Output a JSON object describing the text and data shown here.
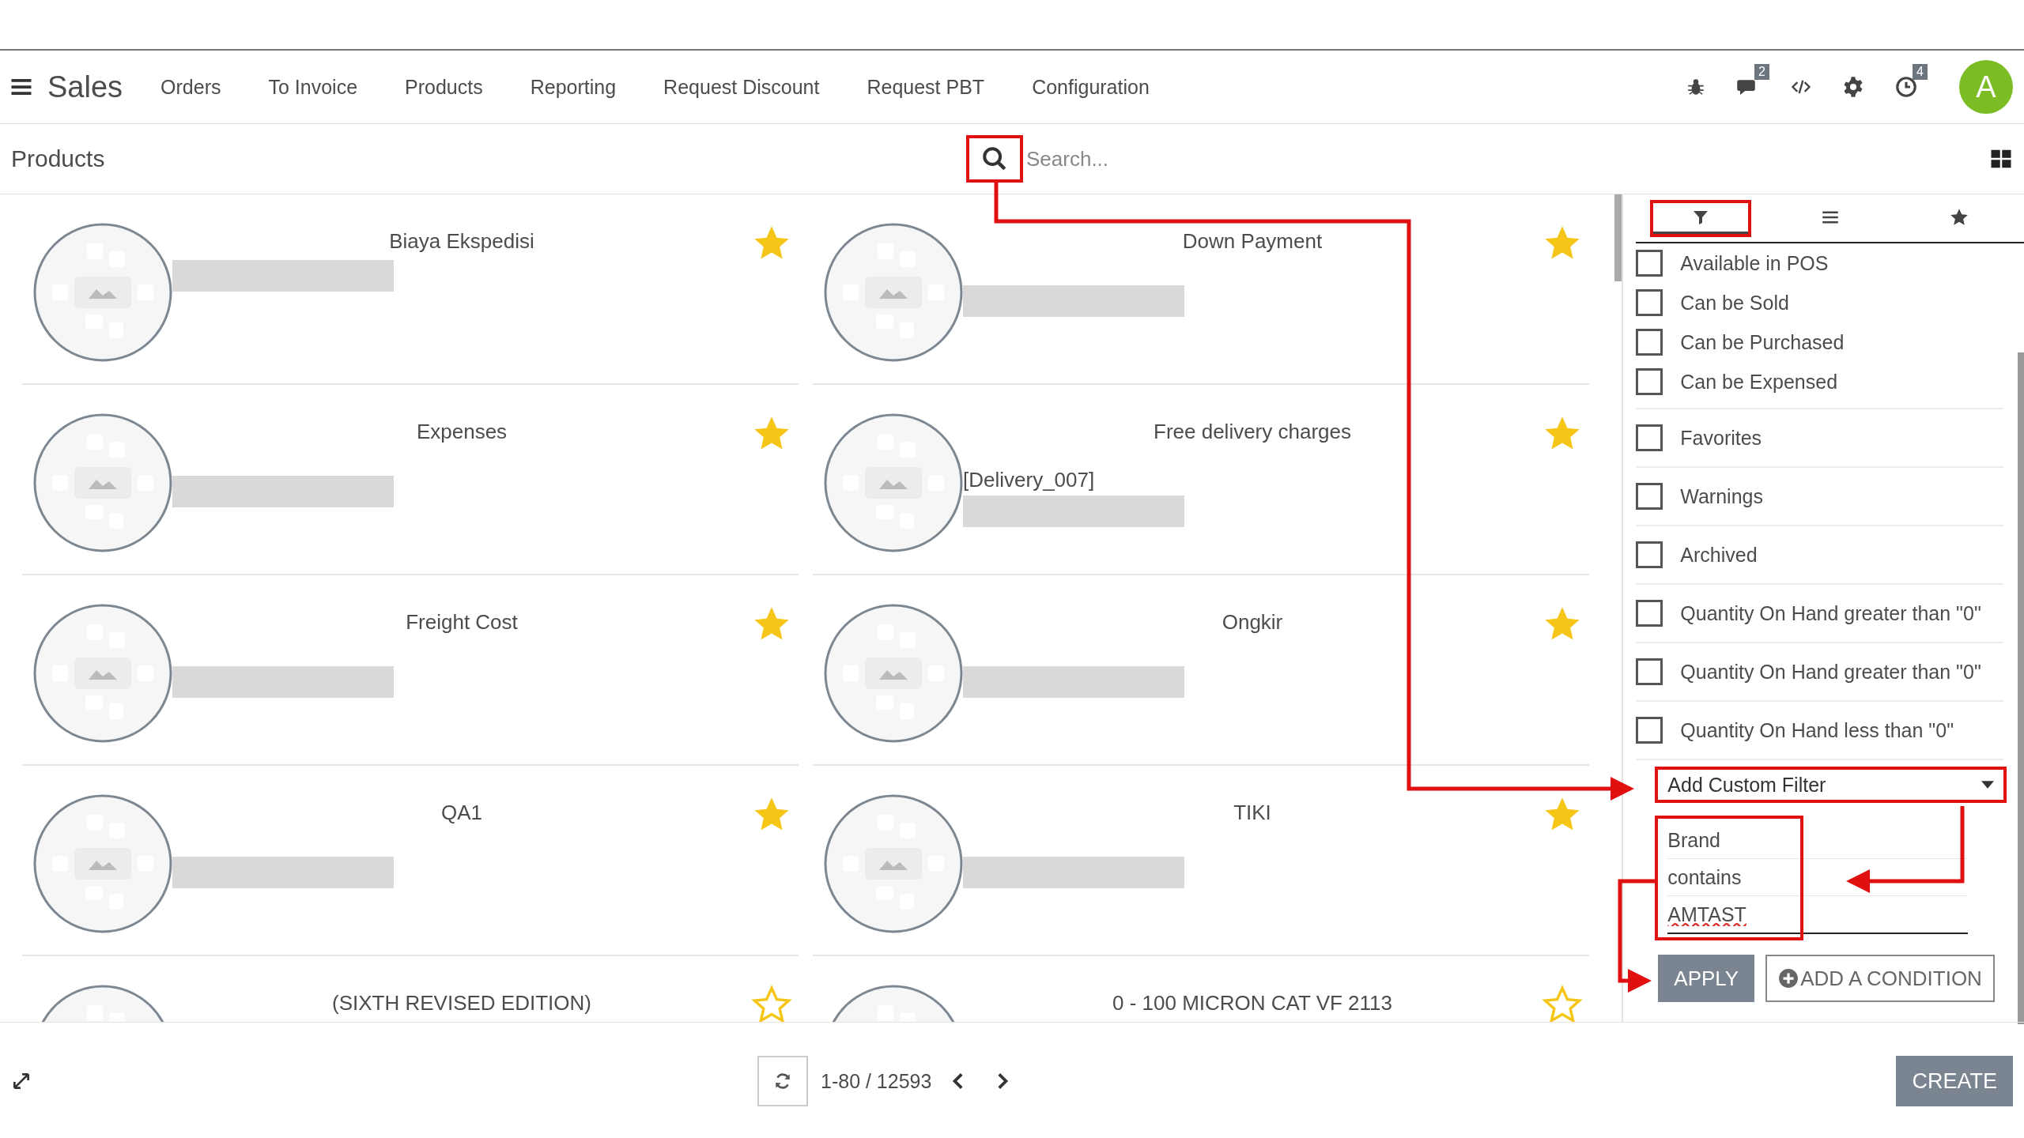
{
  "navbar": {
    "app": "Sales",
    "menu": [
      "Orders",
      "To Invoice",
      "Products",
      "Reporting",
      "Request Discount",
      "Request PBT",
      "Configuration"
    ],
    "systray": [
      {
        "kind": "bug"
      },
      {
        "kind": "chat",
        "badge": "2"
      },
      {
        "kind": "code"
      },
      {
        "kind": "gear"
      },
      {
        "kind": "clock",
        "badge": "4"
      }
    ],
    "avatar": "A"
  },
  "control": {
    "title": "Products",
    "search": {
      "placeholder": "Search...",
      "highlighted": true
    }
  },
  "products": [
    {
      "name": "Biaya Ekspedisi",
      "favorite": true,
      "redacted": true
    },
    {
      "name": "Down Payment",
      "favorite": true,
      "redacted": true
    },
    {
      "name": "Expenses",
      "favorite": true,
      "redacted": true
    },
    {
      "name": "Free delivery charges",
      "reference": "[Delivery_007]",
      "favorite": true,
      "redacted": true
    },
    {
      "name": "Freight Cost",
      "favorite": true,
      "redacted": true
    },
    {
      "name": "Ongkir",
      "favorite": true,
      "redacted": true
    },
    {
      "name": "QA1",
      "favorite": true,
      "redacted": true
    },
    {
      "name": "TIKI",
      "favorite": true,
      "redacted": true
    },
    {
      "name": "(SIXTH REVISED EDITION)",
      "favorite": false
    },
    {
      "name": "0 - 100 MICRON CAT VF 2113",
      "favorite": false
    }
  ],
  "panel": {
    "tabs": [
      {
        "kind": "filter",
        "selected": true,
        "highlighted": true
      },
      {
        "kind": "groupby",
        "selected": false,
        "highlighted": false
      },
      {
        "kind": "favorites",
        "selected": false,
        "highlighted": false
      }
    ],
    "filter_groups": [
      [
        {
          "label": "Available in POS",
          "checked": false
        },
        {
          "label": "Can be Sold",
          "checked": false
        },
        {
          "label": "Can be Purchased",
          "checked": false
        },
        {
          "label": "Can be Expensed",
          "checked": false
        }
      ],
      [
        {
          "label": "Favorites",
          "checked": false
        }
      ],
      [
        {
          "label": "Warnings",
          "checked": false
        }
      ],
      [
        {
          "label": "Archived",
          "checked": false
        }
      ],
      [
        {
          "label": "Quantity On Hand greater than \"0\"",
          "checked": false
        }
      ],
      [
        {
          "label": "Quantity On Hand greater than \"0\"",
          "checked": false
        }
      ],
      [
        {
          "label": "Quantity On Hand less than \"0\"",
          "checked": false
        }
      ]
    ],
    "custom_filter": {
      "label": "Add Custom Filter",
      "highlighted": true
    },
    "condition": {
      "field": "Brand",
      "operator": "contains",
      "value": "AMTAST",
      "highlighted": true
    },
    "buttons": [
      "APPLY",
      "ADD A CONDITION"
    ]
  },
  "pager": {
    "range": "1-80 / 12593"
  },
  "create": "CREATE"
}
